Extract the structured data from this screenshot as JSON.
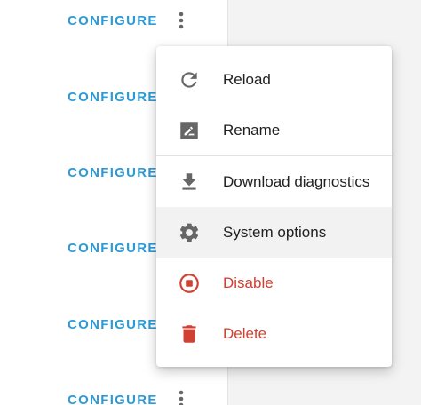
{
  "list": {
    "configure_labels": [
      "CONFIGURE",
      "CONFIGURE",
      "CONFIGURE",
      "CONFIGURE",
      "CONFIGURE",
      "CONFIGURE"
    ]
  },
  "menu": {
    "items": [
      {
        "label": "Reload",
        "icon": "reload-icon"
      },
      {
        "label": "Rename",
        "icon": "rename-icon"
      },
      {
        "label": "Download diagnostics",
        "icon": "download-icon"
      },
      {
        "label": "System options",
        "icon": "gear-icon",
        "highlighted": true
      },
      {
        "label": "Disable",
        "icon": "stop-circle-icon"
      },
      {
        "label": "Delete",
        "icon": "trash-icon"
      }
    ]
  },
  "colors": {
    "accent": "#2d9ad6",
    "danger": "#d04132",
    "icon": "#666666",
    "text": "#212121"
  }
}
